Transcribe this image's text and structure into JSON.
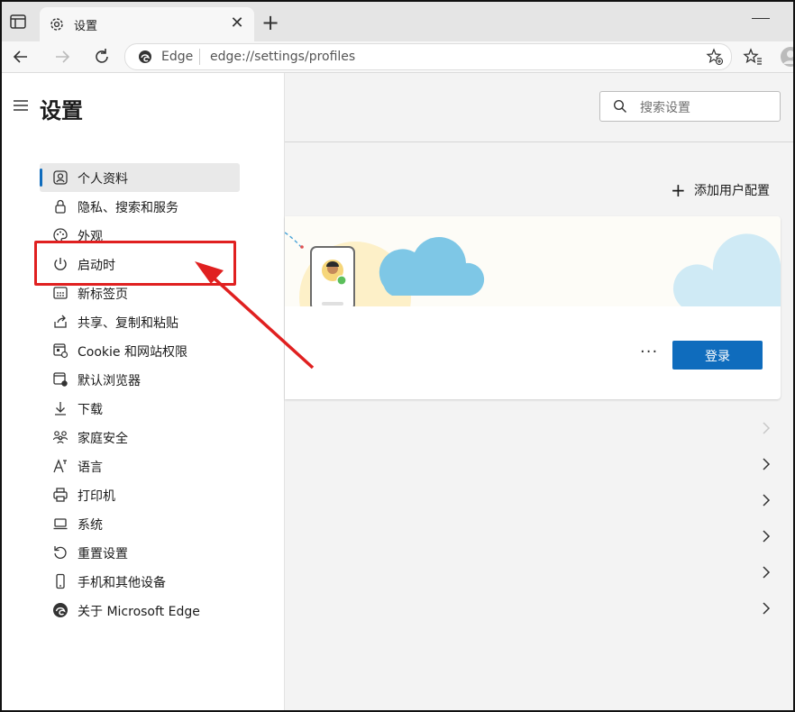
{
  "window": {
    "tab_title": "设置",
    "tab_close": "✕",
    "new_tab": "+"
  },
  "address_bar": {
    "site_name": "Edge",
    "url": "edge://settings/profiles"
  },
  "sidebar": {
    "title": "设置",
    "items": [
      {
        "label": "个人资料",
        "icon": "person-icon",
        "active": true
      },
      {
        "label": "隐私、搜索和服务",
        "icon": "lock-icon"
      },
      {
        "label": "外观",
        "icon": "palette-icon"
      },
      {
        "label": "启动时",
        "icon": "power-icon"
      },
      {
        "label": "新标签页",
        "icon": "grid-icon"
      },
      {
        "label": "共享、复制和粘贴",
        "icon": "share-icon"
      },
      {
        "label": "Cookie 和网站权限",
        "icon": "cookie-icon"
      },
      {
        "label": "默认浏览器",
        "icon": "browser-icon"
      },
      {
        "label": "下载",
        "icon": "download-icon"
      },
      {
        "label": "家庭安全",
        "icon": "family-icon"
      },
      {
        "label": "语言",
        "icon": "language-icon"
      },
      {
        "label": "打印机",
        "icon": "printer-icon"
      },
      {
        "label": "系统",
        "icon": "laptop-icon"
      },
      {
        "label": "重置设置",
        "icon": "reset-icon"
      },
      {
        "label": "手机和其他设备",
        "icon": "phone-icon"
      },
      {
        "label": "关于 Microsoft Edge",
        "icon": "edge-logo-icon"
      }
    ]
  },
  "main": {
    "search_placeholder": "搜索设置",
    "add_profile": "添加用户配置",
    "more_label": "···",
    "signin_label": "登录"
  },
  "colors": {
    "accent": "#0f6cbd",
    "highlight": "#e02020"
  }
}
